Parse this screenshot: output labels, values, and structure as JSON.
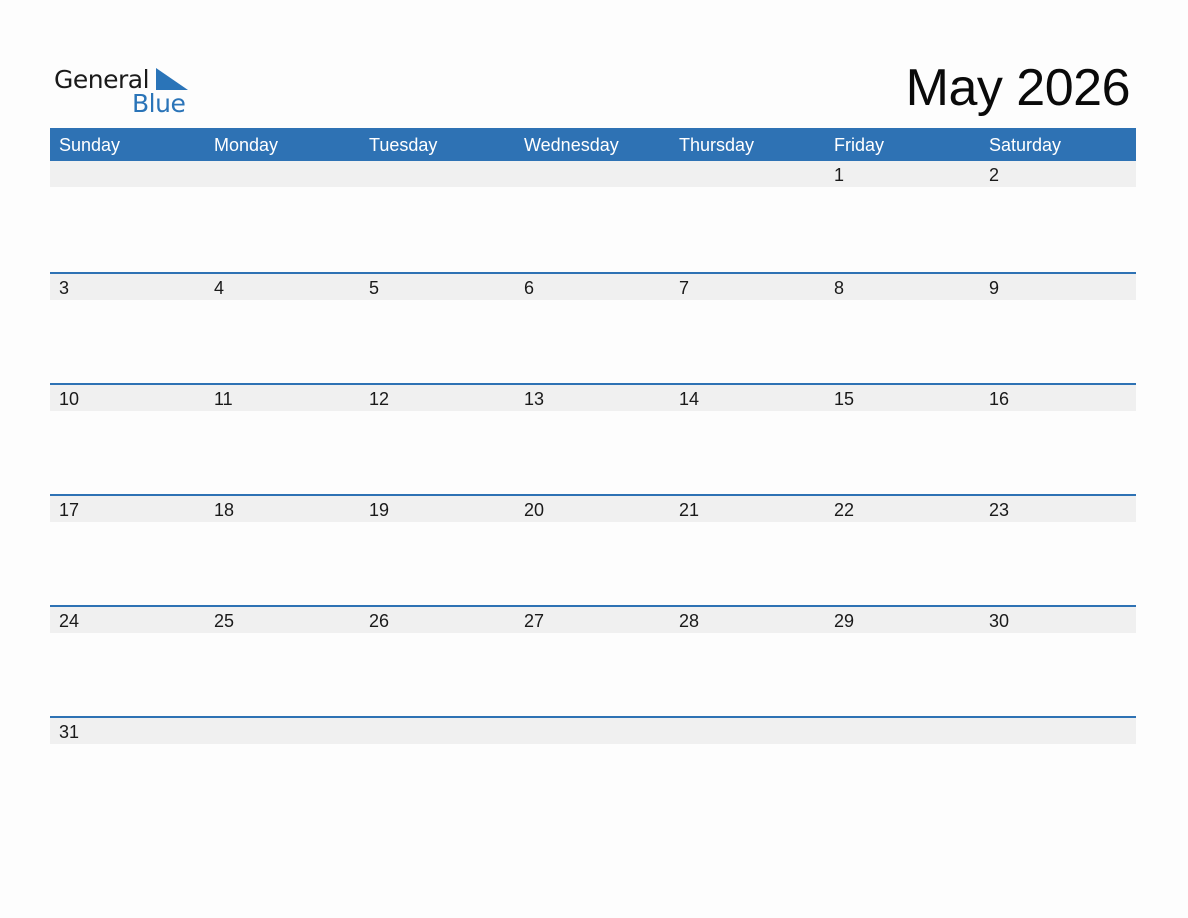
{
  "logo": {
    "line1": "General",
    "line2": "Blue",
    "brand_color": "#2a74b8"
  },
  "title": "May 2026",
  "colors": {
    "header_bg": "#2e72b4",
    "band_bg": "#f0f0f0",
    "separator": "#2e72b4"
  },
  "weekdays": [
    "Sunday",
    "Monday",
    "Tuesday",
    "Wednesday",
    "Thursday",
    "Friday",
    "Saturday"
  ],
  "weeks": [
    [
      "",
      "",
      "",
      "",
      "",
      "1",
      "2"
    ],
    [
      "3",
      "4",
      "5",
      "6",
      "7",
      "8",
      "9"
    ],
    [
      "10",
      "11",
      "12",
      "13",
      "14",
      "15",
      "16"
    ],
    [
      "17",
      "18",
      "19",
      "20",
      "21",
      "22",
      "23"
    ],
    [
      "24",
      "25",
      "26",
      "27",
      "28",
      "29",
      "30"
    ],
    [
      "31",
      "",
      "",
      "",
      "",
      "",
      ""
    ]
  ]
}
